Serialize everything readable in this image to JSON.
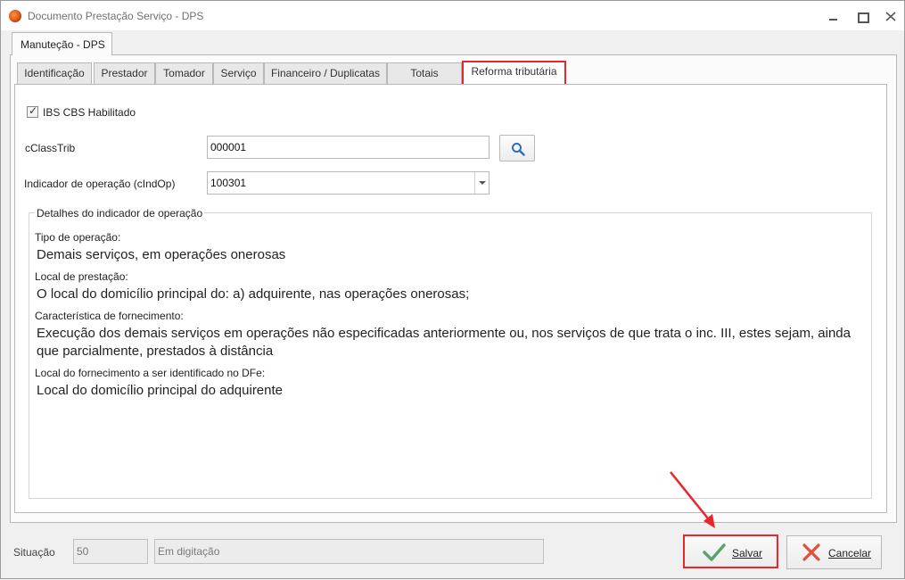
{
  "window": {
    "title": "Documento Prestação Serviço - DPS"
  },
  "outer_tab": {
    "label": "Manuteção - DPS"
  },
  "tabs": [
    {
      "label": "Identificação"
    },
    {
      "label": "Prestador"
    },
    {
      "label": "Tomador"
    },
    {
      "label": "Serviço"
    },
    {
      "label": "Financeiro / Duplicatas"
    },
    {
      "label": "Totais"
    },
    {
      "label": "Reforma tributária",
      "active": true
    }
  ],
  "form": {
    "ibs_cbs_label": "IBS CBS Habilitado",
    "ibs_cbs_checked": true,
    "cclasstrib_label": "cClassTrib",
    "cclasstrib_value": "000001",
    "indop_label": "Indicador de operação (cIndOp)",
    "indop_value": "100301"
  },
  "details": {
    "group_title": "Detalhes do indicador de operação",
    "tipo_label": "Tipo de operação:",
    "tipo_value": "Demais serviços, em operações onerosas",
    "local_label": "Local de prestação:",
    "local_value": "O local do domicílio principal do: a) adquirente, nas operações onerosas;",
    "carac_label": "Característica de fornecimento:",
    "carac_value": "Execução dos demais serviços em operações não especificadas anteriormente ou, nos serviços de que trata o inc. III, estes sejam, ainda que parcialmente, prestados à distância",
    "dfe_label": "Local do fornecimento a ser identificado no DFe:",
    "dfe_value": "Local do domicílio principal do adquirente"
  },
  "status": {
    "label": "Situação",
    "code": "50",
    "text": "Em digitação"
  },
  "buttons": {
    "save_label": "Salvar",
    "cancel_label": "Cancelar"
  },
  "colors": {
    "highlight": "#e8262c",
    "save_icon": "#5aa469",
    "cancel_icon": "#e0503a",
    "search_icon": "#2f6fb6"
  }
}
